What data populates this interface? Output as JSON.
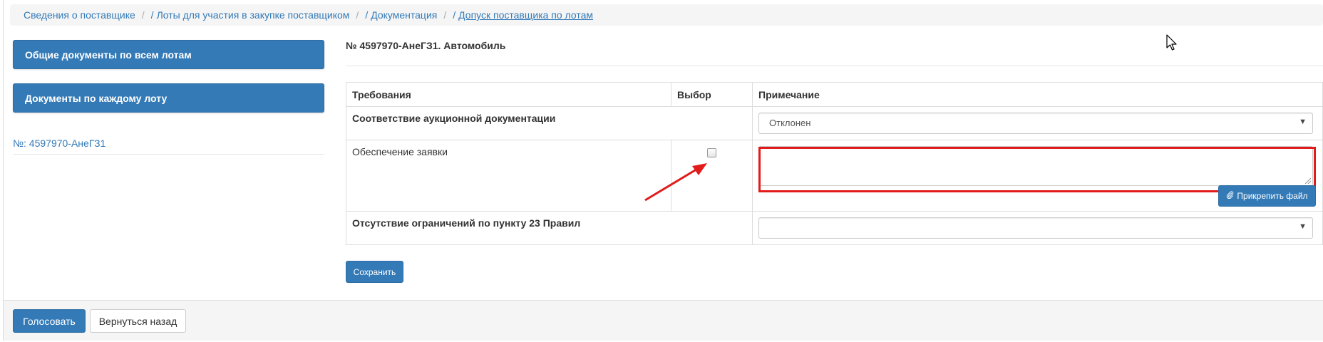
{
  "breadcrumb": {
    "items": [
      "Сведения о поставщике",
      "Лоты для участия в закупке поставщиком",
      "Документация",
      "Допуск поставщика по лотам"
    ]
  },
  "sidebar": {
    "common_docs_label": "Общие документы по всем лотам",
    "per_lot_docs_label": "Документы по каждому лоту",
    "lot_link": "№: 4597970-АнеГЗ1"
  },
  "main": {
    "lot_title": "№ 4597970-АнеГЗ1. Автомобиль",
    "table": {
      "headers": [
        "Требования",
        "Выбор",
        "Примечание"
      ],
      "rows": [
        {
          "requirement": "Соответствие аукционной документации",
          "note_select_value": "Отклонен"
        },
        {
          "requirement": "Обеспечение заявки",
          "note_textarea_value": ""
        },
        {
          "requirement": "Отсутствие ограничений по пункту 23 Правил",
          "note_select_value": ""
        }
      ]
    },
    "attach_label": "Прикрепить файл",
    "save_label": "Сохранить"
  },
  "footer": {
    "vote_label": "Голосовать",
    "back_label": "Вернуться назад"
  },
  "colors": {
    "primary": "#337ab7",
    "annotation": "#e21b1b"
  }
}
